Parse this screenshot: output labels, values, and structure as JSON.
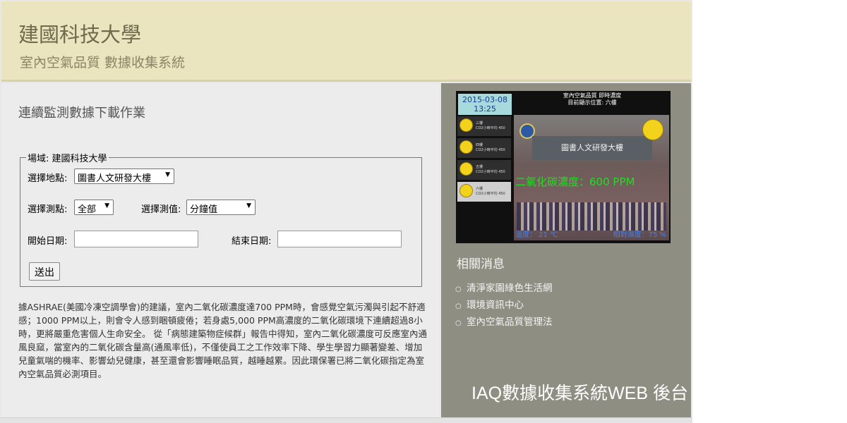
{
  "header": {
    "title": "建國科技大學",
    "subtitle": "室內空氣品質 數據收集系統"
  },
  "main": {
    "heading": "連續監測數據下載作業",
    "form": {
      "legend": "場域: 建國科技大學",
      "location_label": "選擇地點:",
      "location_value": "圖書人文研發大樓",
      "point_label": "選擇測點:",
      "point_value": "全部",
      "measure_label": "選擇測值:",
      "measure_value": "分鐘值",
      "start_label": "開始日期:",
      "start_value": "",
      "end_label": "結束日期:",
      "end_value": "",
      "submit_label": "送出"
    },
    "description": "據ASHRAE(美國冷凍空調學會)的建議，室內二氧化碳濃度達700 PPM時，會感覺空氣污濁與引起不舒適感；1000 PPM以上，則會令人感到睏頓疲倦；若身處5,000 PPM高濃度的二氧化碳環境下連續超過8小時，更將嚴重危害個人生命安全。 從「病態建築物症候群」報告中得知，室內二氧化碳濃度可反應室內通風良窳，當室內的二氧化碳含量高(通風率低)，不僅使員工之工作效率下降、學生學習力顯著變差、增加兒童氣喘的機率、影響幼兒健康，甚至還會影響睡眠品質，越睡越累。因此環保署已將二氧化碳指定為室內空氣品質必測項目。"
  },
  "display": {
    "date": "2015-03-08",
    "time": "13:25",
    "title_line1": "室內空氣品質 即時濃度",
    "title_line2": "目前顯示位置: 六樓",
    "locations": [
      {
        "name": "三樓",
        "detail": "CO2小時平均 450"
      },
      {
        "name": "四樓",
        "detail": "CO2小時平均 450"
      },
      {
        "name": "五樓",
        "detail": "CO2小時平均 450"
      },
      {
        "name": "六樓",
        "detail": "CO2小時平均 450"
      }
    ],
    "building_sign": "圖書人文研發大樓",
    "co2_reading": "二氧化碳濃度：600  PPM",
    "temperature": "溫度： 21 ℃",
    "humidity": "相對濕度：75 %"
  },
  "side": {
    "news_heading": "相關消息",
    "news_items": [
      "清淨家園綠色生活網",
      "環境資訊中心",
      "室內空氣品質管理法"
    ],
    "footer_title": "IAQ數據收集系統WEB 後台"
  },
  "colors": {
    "header_bg": "#ebe5bf",
    "main_bg": "#ececec",
    "side_bg": "#8e8e82",
    "co2_text": "#22dd22"
  }
}
